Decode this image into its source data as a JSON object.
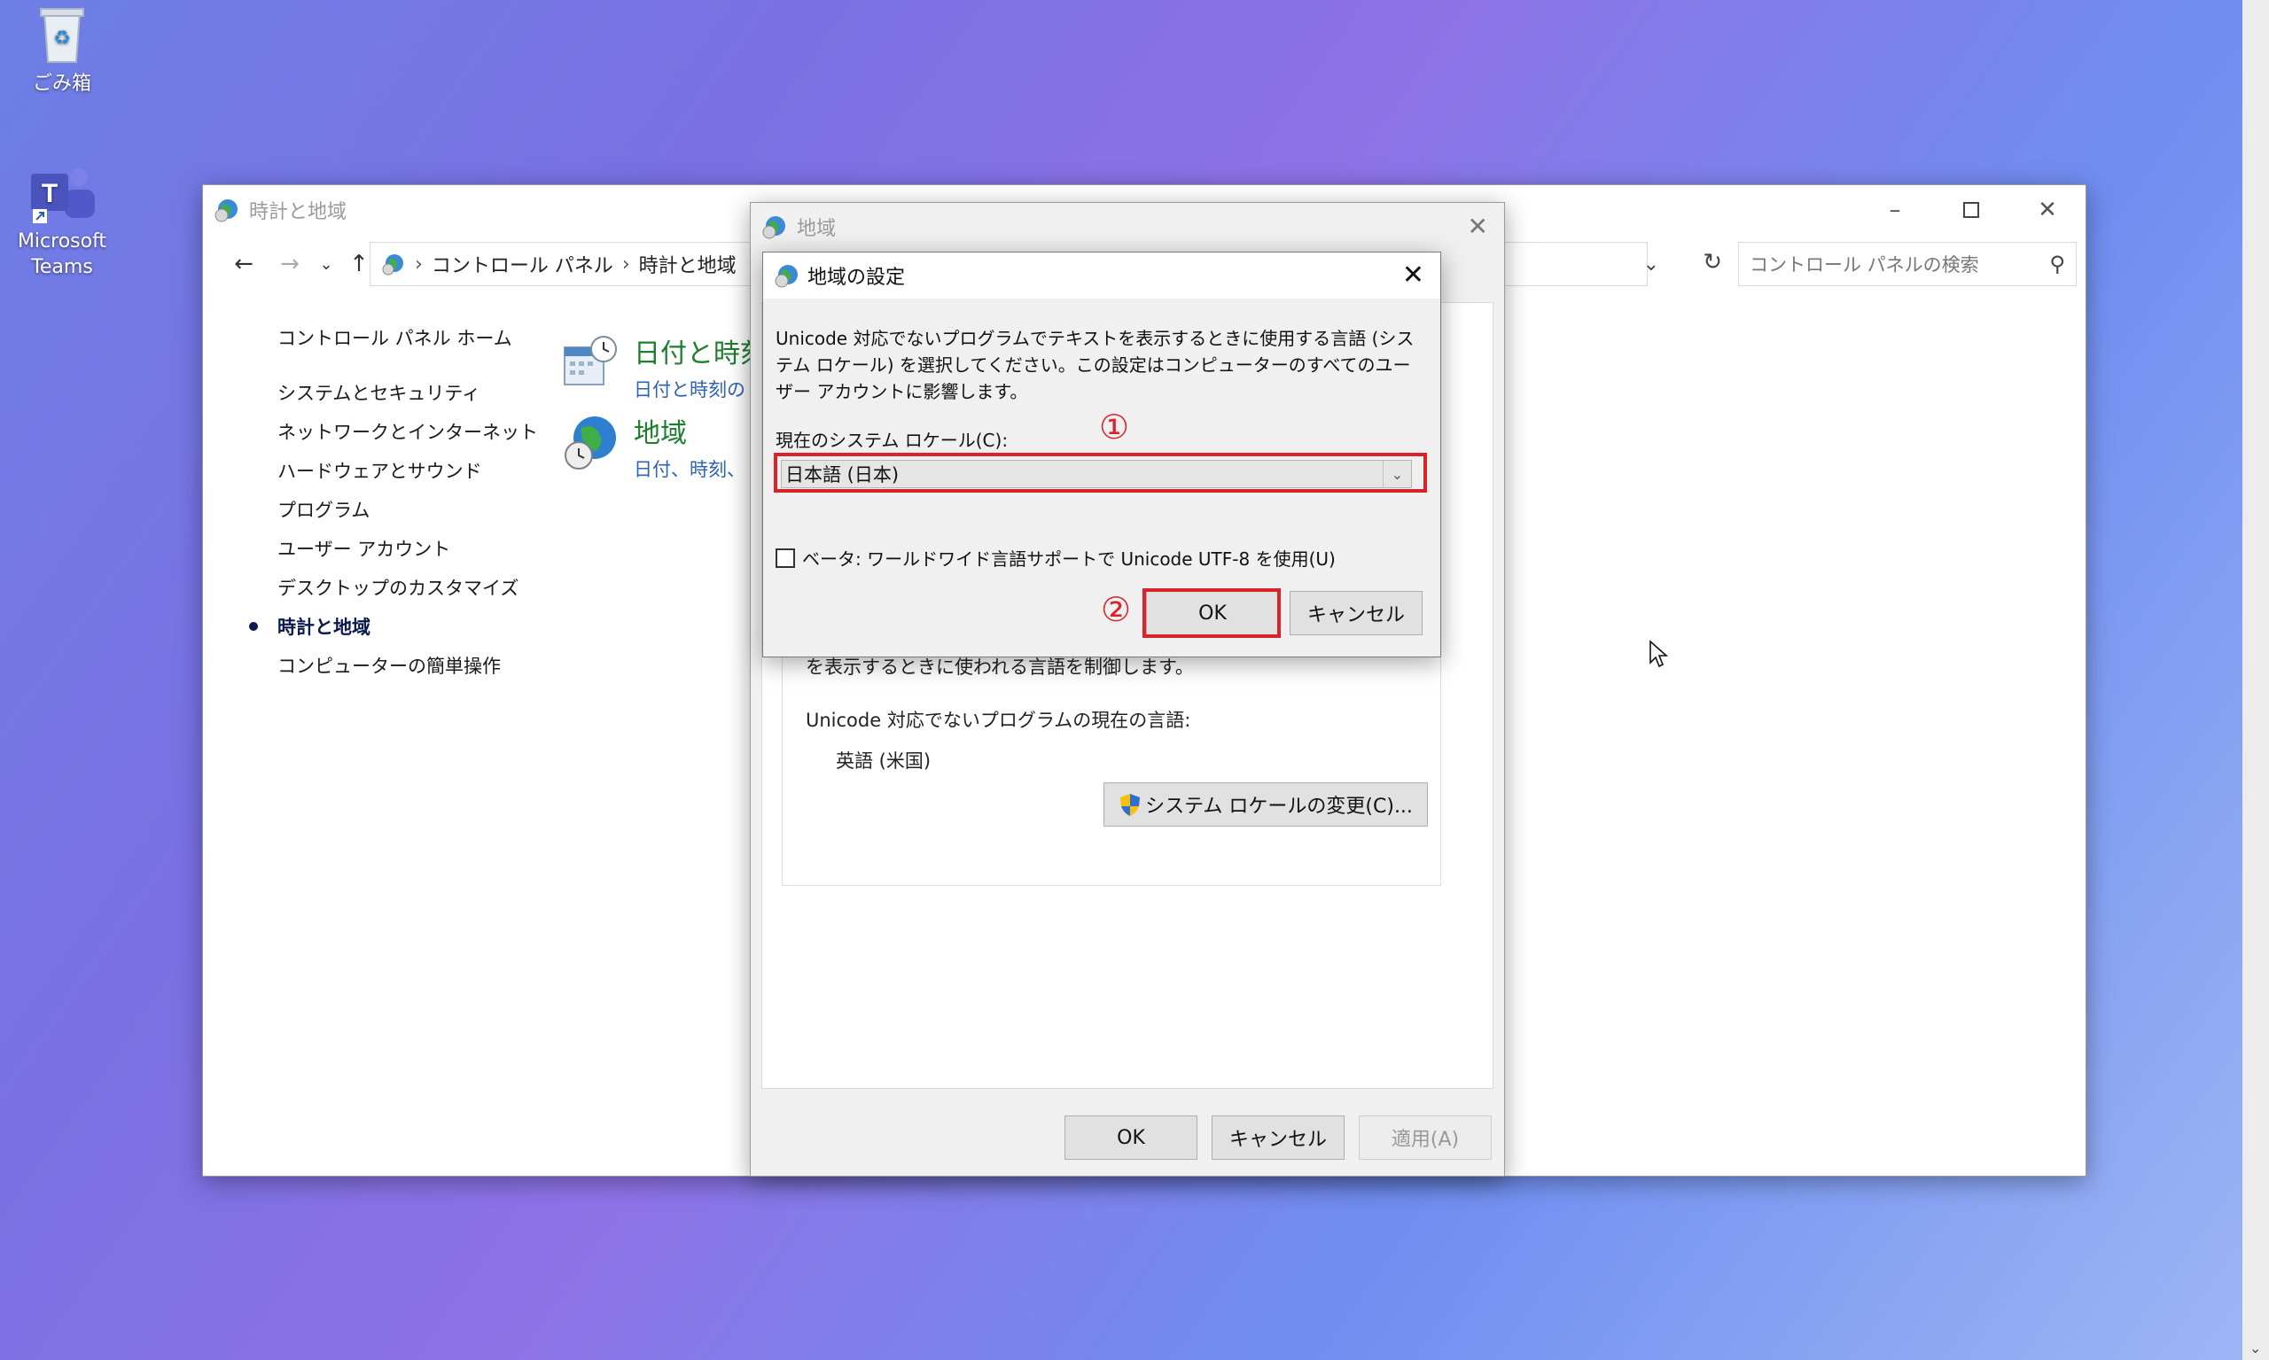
{
  "desktop": {
    "recycle_bin_label": "ごみ箱",
    "teams_label": "Microsoft Teams"
  },
  "cp_window": {
    "title": "時計と地域",
    "breadcrumb": [
      "コントロール パネル",
      "時計と地域"
    ],
    "search_placeholder": "コントロール パネルの検索",
    "sidebar": [
      "コントロール パネル ホーム",
      "システムとセキュリティ",
      "ネットワークとインターネット",
      "ハードウェアとサウンド",
      "プログラム",
      "ユーザー アカウント",
      "デスクトップのカスタマイズ",
      "時計と地域",
      "コンピューターの簡単操作"
    ],
    "category_datetime": {
      "title": "日付と時刻",
      "sub": "日付と時刻の"
    },
    "category_region": {
      "title": "地域",
      "sub": "日付、時刻、"
    }
  },
  "region_dialog": {
    "title": "地域",
    "desc_tail": "を表示するときに使われる言語を制御します。",
    "current_lang_label": "Unicode 対応でないプログラムの現在の言語:",
    "current_lang_value": "英語 (米国)",
    "change_locale_button": "システム ロケールの変更(C)...",
    "ok": "OK",
    "cancel": "キャンセル",
    "apply": "適用(A)"
  },
  "settings_dialog": {
    "title": "地域の設定",
    "description": "Unicode 対応でないプログラムでテキストを表示するときに使用する言語 (システム ロケール) を選択してください。この設定はコンピューターのすべてのユーザー アカウントに影響します。",
    "locale_label": "現在のシステム ロケール(C):",
    "locale_value": "日本語 (日本)",
    "beta_checkbox": "ベータ: ワールドワイド言語サポートで Unicode UTF-8 を使用(U)",
    "beta_checked": false,
    "ok": "OK",
    "cancel": "キャンセル"
  },
  "annotations": {
    "step1": "①",
    "step2": "②",
    "highlight_color": "#d9232b"
  }
}
